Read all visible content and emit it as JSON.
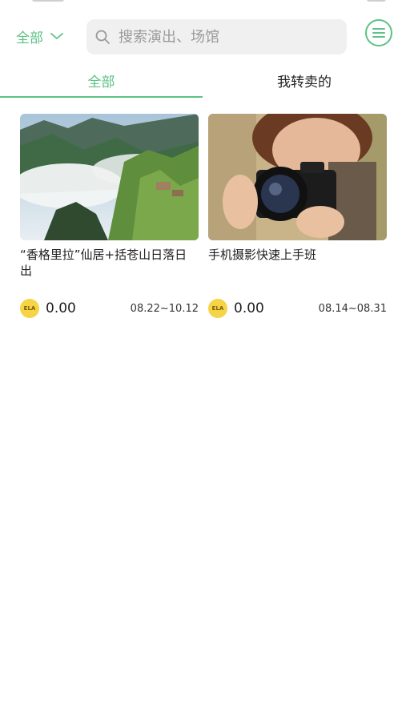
{
  "header": {
    "filter_label": "全部",
    "search_placeholder": "搜索演出、场馆",
    "accent_color": "#5cc285"
  },
  "tabs": [
    {
      "label": "全部",
      "active": true
    },
    {
      "label": "我转卖的",
      "active": false
    }
  ],
  "cards": [
    {
      "title": "“香格里拉”仙居+括苍山日落日出",
      "coin_label": "ELA",
      "price": "0.00",
      "date_range": "08.22~10.12",
      "image": "mountain-landscape"
    },
    {
      "title": "手机摄影快速上手班",
      "coin_label": "ELA",
      "price": "0.00",
      "date_range": "08.14~08.31",
      "image": "photographer-with-camera"
    }
  ]
}
